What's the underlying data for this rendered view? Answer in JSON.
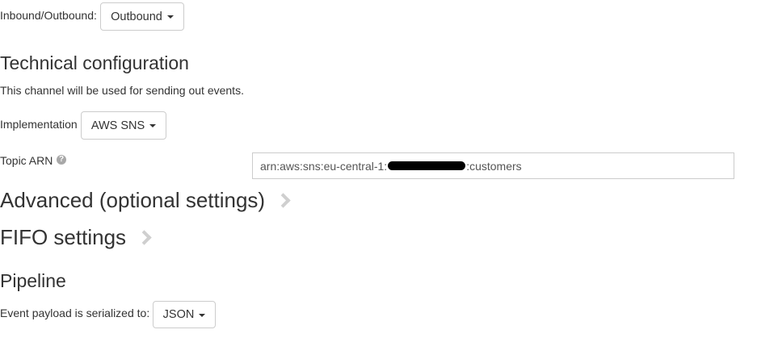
{
  "direction": {
    "label": "Inbound/Outbound:",
    "selected": "Outbound"
  },
  "technical": {
    "heading": "Technical configuration",
    "description": "This channel will be used for sending out events.",
    "implementation_label": "Implementation",
    "implementation_selected": "AWS SNS",
    "topic_label": "Topic ARN",
    "topic_help_icon": "question-circle-icon",
    "topic_value_prefix": "arn:aws:sns:eu-central-1:",
    "topic_value_suffix": ":customers"
  },
  "advanced": {
    "heading": "Advanced (optional settings)"
  },
  "fifo": {
    "heading": "FIFO settings"
  },
  "pipeline": {
    "heading": "Pipeline",
    "serialize_label": "Event payload is serialized to:",
    "serialize_selected": "JSON"
  },
  "colors": {
    "text": "#333333",
    "border": "#cccccc",
    "chevron": "#cfcfcf",
    "redaction": "#000000"
  }
}
